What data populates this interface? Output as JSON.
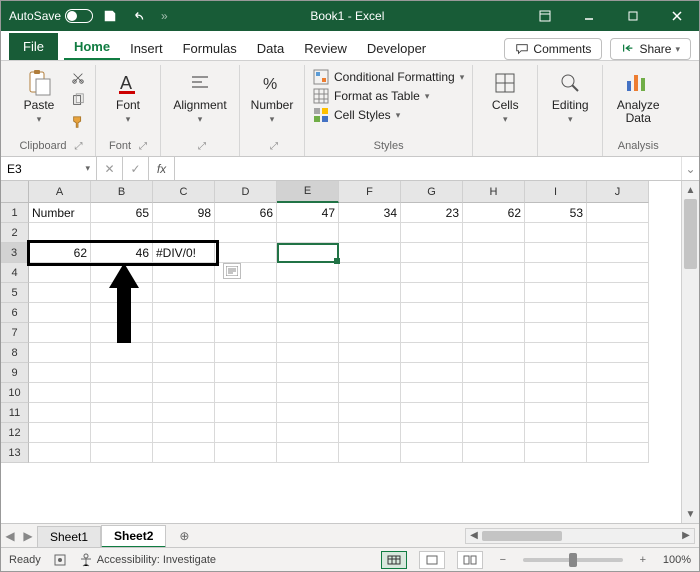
{
  "title": {
    "autosave_label": "AutoSave",
    "doc": "Book1",
    "app": "Excel"
  },
  "tabs": {
    "file": "File",
    "items": [
      "Home",
      "Insert",
      "Formulas",
      "Data",
      "Review",
      "Developer"
    ],
    "active": "Home",
    "comments": "Comments",
    "share": "Share"
  },
  "ribbon": {
    "clipboard": {
      "paste": "Paste",
      "label": "Clipboard"
    },
    "font": {
      "btn": "Font",
      "label": "Font"
    },
    "alignment": {
      "btn": "Alignment",
      "label": ""
    },
    "number": {
      "btn": "Number",
      "label": ""
    },
    "styles": {
      "cond": "Conditional Formatting",
      "table": "Format as Table",
      "cell": "Cell Styles",
      "label": "Styles"
    },
    "cells": {
      "btn": "Cells"
    },
    "editing": {
      "btn": "Editing"
    },
    "analysis": {
      "btn": "Analyze\nData",
      "label": "Analysis"
    }
  },
  "fbar": {
    "namebox": "E3",
    "formula": ""
  },
  "grid": {
    "columns": [
      "A",
      "B",
      "C",
      "D",
      "E",
      "F",
      "G",
      "H",
      "I",
      "J"
    ],
    "rows": 13,
    "row1": {
      "A": "Number",
      "B": "65",
      "C": "98",
      "D": "66",
      "E": "47",
      "F": "34",
      "G": "23",
      "H": "62",
      "I": "53"
    },
    "row3": {
      "A": "62",
      "B": "46",
      "C": "#DIV/0!"
    },
    "selected_cell": "E3"
  },
  "sheets": {
    "items": [
      "Sheet1",
      "Sheet2"
    ],
    "active": "Sheet2"
  },
  "status": {
    "ready": "Ready",
    "access": "Accessibility: Investigate",
    "zoom": "100%"
  }
}
